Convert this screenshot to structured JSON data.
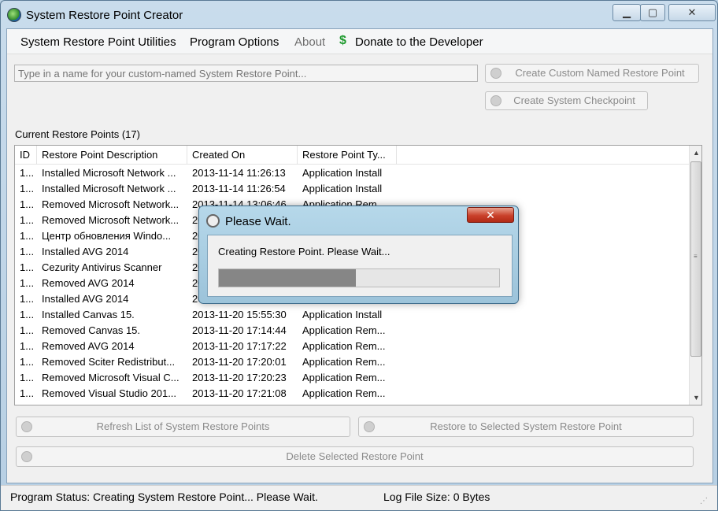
{
  "window": {
    "title": "System Restore Point Creator"
  },
  "titlebar_buttons": {
    "minimize": "▁",
    "maximize": "▢",
    "close": "✕"
  },
  "menu": {
    "items": [
      {
        "label": "System Restore Point Utilities"
      },
      {
        "label": "Program Options"
      },
      {
        "label": "About"
      },
      {
        "label": "Donate to the Developer"
      }
    ]
  },
  "restore_name_input": {
    "placeholder": "Type in a name for your custom-named System Restore Point..."
  },
  "buttons": {
    "create_custom": "Create Custom Named Restore Point",
    "create_checkpoint": "Create System Checkpoint",
    "refresh": "Refresh List of System Restore Points",
    "restore_selected": "Restore to Selected System Restore Point",
    "delete_selected": "Delete Selected Restore Point"
  },
  "list": {
    "section_label": "Current Restore Points (17)",
    "columns": [
      "ID",
      "Restore Point Description",
      "Created On",
      "Restore Point Ty..."
    ],
    "rows": [
      {
        "id": "1...",
        "description": "Installed Microsoft Network ...",
        "created": "2013-11-14 11:26:13",
        "type": "Application Install"
      },
      {
        "id": "1...",
        "description": "Installed Microsoft Network ...",
        "created": "2013-11-14 11:26:54",
        "type": "Application Install"
      },
      {
        "id": "1...",
        "description": "Removed Microsoft Network...",
        "created": "2013-11-14 13:06:46",
        "type": "Application Rem..."
      },
      {
        "id": "1...",
        "description": "Removed Microsoft Network...",
        "created": "20",
        "type": ""
      },
      {
        "id": "1...",
        "description": "Центр обновления Windo...",
        "created": "20",
        "type": ""
      },
      {
        "id": "1...",
        "description": "Installed AVG 2014",
        "created": "20",
        "type": ""
      },
      {
        "id": "1...",
        "description": "Cezurity Antivirus Scanner",
        "created": "20",
        "type": ""
      },
      {
        "id": "1...",
        "description": "Removed AVG 2014",
        "created": "20",
        "type": ""
      },
      {
        "id": "1...",
        "description": "Installed AVG 2014",
        "created": "20",
        "type": ""
      },
      {
        "id": "1...",
        "description": "Installed Canvas 15.",
        "created": "2013-11-20 15:55:30",
        "type": "Application Install"
      },
      {
        "id": "1...",
        "description": "Removed Canvas 15.",
        "created": "2013-11-20 17:14:44",
        "type": "Application Rem..."
      },
      {
        "id": "1...",
        "description": "Removed AVG 2014",
        "created": "2013-11-20 17:17:22",
        "type": "Application Rem..."
      },
      {
        "id": "1...",
        "description": "Removed Sciter Redistribut...",
        "created": "2013-11-20 17:20:01",
        "type": "Application Rem..."
      },
      {
        "id": "1...",
        "description": "Removed Microsoft Visual C...",
        "created": "2013-11-20 17:20:23",
        "type": "Application Rem..."
      },
      {
        "id": "1...",
        "description": "Removed Visual Studio 201...",
        "created": "2013-11-20 17:21:08",
        "type": "Application Rem..."
      }
    ]
  },
  "dialog": {
    "title": "Please Wait.",
    "close": "✕",
    "message": "Creating Restore Point.  Please Wait...",
    "progress_percent": 49
  },
  "status": {
    "program_status": "Program Status:  Creating System Restore Point... Please Wait.",
    "log_size": "Log File Size:  0 Bytes"
  }
}
